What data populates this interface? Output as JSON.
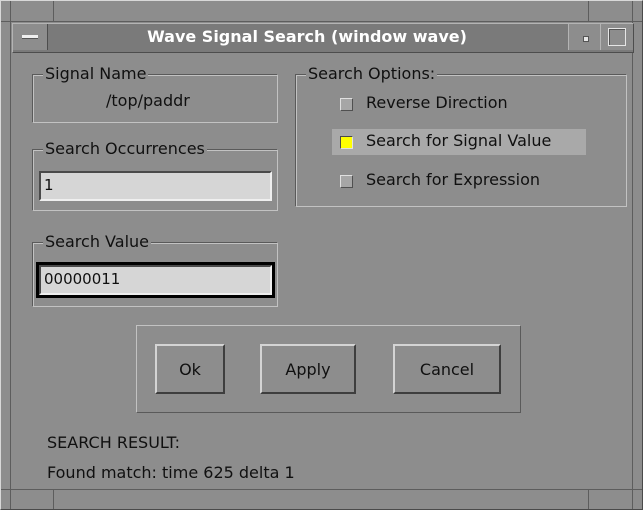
{
  "window": {
    "title": "Wave Signal Search (window wave)"
  },
  "signal_name": {
    "label": "Signal Name",
    "value": "/top/paddr"
  },
  "occurrences": {
    "label": "Search Occurrences",
    "value": "1"
  },
  "search_value": {
    "label": "Search Value",
    "value": "00000011"
  },
  "options": {
    "label": "Search Options:",
    "items": [
      {
        "label": "Reverse Direction",
        "selected": false
      },
      {
        "label": "Search for Signal Value",
        "selected": true
      },
      {
        "label": "Search for Expression",
        "selected": false
      }
    ]
  },
  "buttons": {
    "ok": "Ok",
    "apply": "Apply",
    "cancel": "Cancel"
  },
  "result": {
    "heading": "SEARCH RESULT:",
    "message": "Found match: time 625 delta 1"
  },
  "colors": {
    "background": "#8d8d8d",
    "indicator_on": "#ffff00",
    "title_text": "#ffffff"
  }
}
